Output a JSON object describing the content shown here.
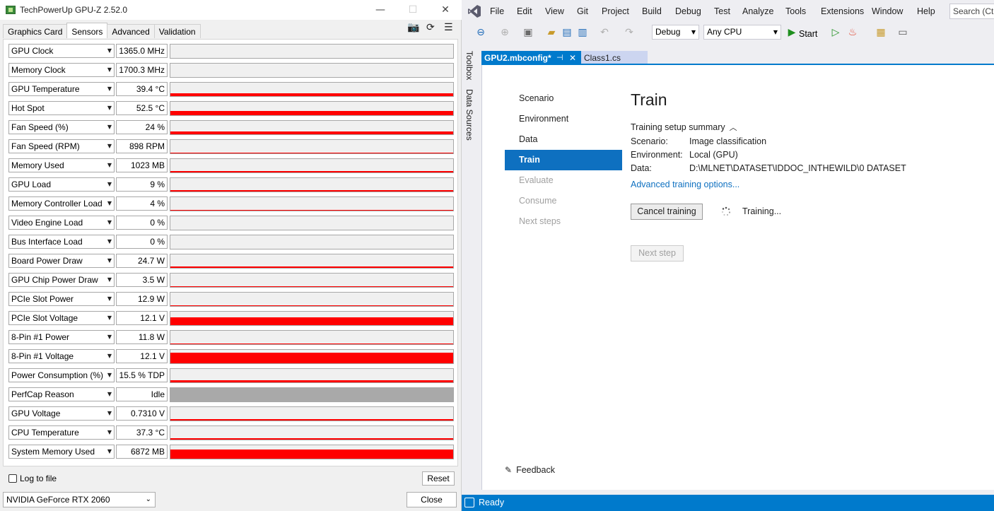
{
  "gpuz": {
    "title": "TechPowerUp GPU-Z 2.52.0",
    "window_buttons": {
      "minimize": "—",
      "maximize": "☐",
      "close": "✕"
    },
    "tabs": [
      {
        "label": "Graphics Card",
        "active": false
      },
      {
        "label": "Sensors",
        "active": true
      },
      {
        "label": "Advanced",
        "active": false
      },
      {
        "label": "Validation",
        "active": false
      }
    ],
    "toolbar": {
      "camera_icon": "📷",
      "refresh_icon": "⟳",
      "menu_icon": "☰"
    },
    "sensors": [
      {
        "name": "GPU Clock",
        "value": "1365.0 MHz",
        "level": 0,
        "gray": false
      },
      {
        "name": "Memory Clock",
        "value": "1700.3 MHz",
        "level": 0,
        "gray": false
      },
      {
        "name": "GPU Temperature",
        "value": "39.4 °C",
        "level": 0.2,
        "gray": false
      },
      {
        "name": "Hot Spot",
        "value": "52.5 °C",
        "level": 0.3,
        "gray": false
      },
      {
        "name": "Fan Speed (%)",
        "value": "24 %",
        "level": 0.2,
        "gray": false
      },
      {
        "name": "Fan Speed (RPM)",
        "value": "898 RPM",
        "level": 0.05,
        "gray": false
      },
      {
        "name": "Memory Used",
        "value": "1023 MB",
        "level": 0.12,
        "gray": false
      },
      {
        "name": "GPU Load",
        "value": "9 %",
        "level": 0.09,
        "gray": false
      },
      {
        "name": "Memory Controller Load",
        "value": "4 %",
        "level": 0.04,
        "gray": false
      },
      {
        "name": "Video Engine Load",
        "value": "0 %",
        "level": 0,
        "gray": false
      },
      {
        "name": "Bus Interface Load",
        "value": "0 %",
        "level": 0,
        "gray": false
      },
      {
        "name": "Board Power Draw",
        "value": "24.7 W",
        "level": 0.08,
        "gray": false
      },
      {
        "name": "GPU Chip Power Draw",
        "value": "3.5 W",
        "level": 0.03,
        "gray": false
      },
      {
        "name": "PCIe Slot Power",
        "value": "12.9 W",
        "level": 0.05,
        "gray": false
      },
      {
        "name": "PCIe Slot Voltage",
        "value": "12.1 V",
        "level": 0.6,
        "gray": false
      },
      {
        "name": "8-Pin #1 Power",
        "value": "11.8 W",
        "level": 0.05,
        "gray": false
      },
      {
        "name": "8-Pin #1 Voltage",
        "value": "12.1 V",
        "level": 0.8,
        "gray": false
      },
      {
        "name": "Power Consumption (%)",
        "value": "15.5 % TDP",
        "level": 0.15,
        "gray": false
      },
      {
        "name": "PerfCap Reason",
        "value": "Idle",
        "level": 1,
        "gray": true
      },
      {
        "name": "GPU Voltage",
        "value": "0.7310 V",
        "level": 0.12,
        "gray": false
      },
      {
        "name": "CPU Temperature",
        "value": "37.3 °C",
        "level": 0.08,
        "gray": false
      },
      {
        "name": "System Memory Used",
        "value": "6872 MB",
        "level": 0.7,
        "gray": false
      }
    ],
    "log_to_file_label": "Log to file",
    "reset_label": "Reset",
    "gpu_select": "NVIDIA GeForce RTX 2060",
    "close_label": "Close",
    "colors": {
      "graph_fill": "#ff0000",
      "graph_gray": "#a9a9a9"
    }
  },
  "vs": {
    "menu": [
      "File",
      "Edit",
      "View",
      "Git",
      "Project",
      "Build",
      "Debug",
      "Test",
      "Analyze",
      "Tools",
      "Extensions",
      "Window",
      "Help"
    ],
    "search_placeholder": "Search (Ctrl",
    "toolbar": {
      "config": "Debug",
      "platform": "Any CPU",
      "start_label": "Start",
      "icons": [
        "back-icon",
        "forward-icon",
        "new-project-icon",
        "open-folder-icon",
        "save-icon",
        "save-all-icon",
        "undo-icon",
        "redo-icon",
        "start-icon",
        "start-without-debug-icon",
        "hot-reload-icon",
        "solution-explorer-icon",
        "window-layout-icon"
      ]
    },
    "side_tabs": [
      "Toolbox",
      "Data Sources"
    ],
    "doc_tabs": [
      {
        "label": "GPU2.mbconfig*",
        "active": true
      },
      {
        "label": "Class1.cs",
        "active": false
      }
    ],
    "nav": [
      {
        "label": "Scenario",
        "state": "normal"
      },
      {
        "label": "Environment",
        "state": "normal"
      },
      {
        "label": "Data",
        "state": "normal"
      },
      {
        "label": "Train",
        "state": "selected"
      },
      {
        "label": "Evaluate",
        "state": "disabled"
      },
      {
        "label": "Consume",
        "state": "disabled"
      },
      {
        "label": "Next steps",
        "state": "disabled"
      }
    ],
    "pane": {
      "title": "Train",
      "summary_label": "Training setup summary",
      "summary": [
        {
          "key": "Scenario:",
          "value": "Image classification"
        },
        {
          "key": "Environment:",
          "value": "Local (GPU)"
        },
        {
          "key": "Data:",
          "value": "D:\\MLNET\\DATASET\\IDDOC_INTHEWILD\\0 DATASET"
        }
      ],
      "advanced_link": "Advanced training options...",
      "cancel_button": "Cancel training",
      "status_text": "Training...",
      "next_button": "Next step"
    },
    "feedback_label": "Feedback",
    "status_bar": "Ready",
    "colors": {
      "accent": "#007acc",
      "nav_selected": "#0e70c0",
      "link": "#0e70c0"
    }
  }
}
